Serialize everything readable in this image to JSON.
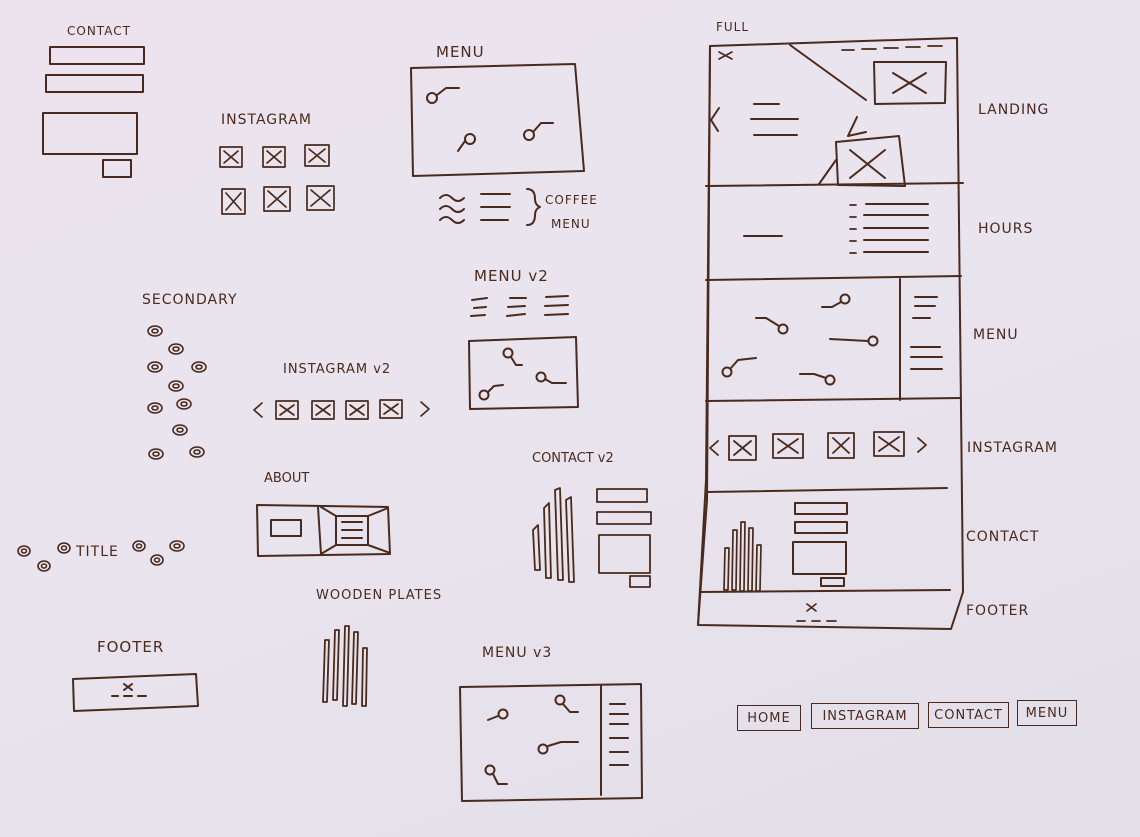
{
  "sketches": {
    "contact": "CONTACT",
    "instagram": "INSTAGRAM",
    "menu": "MENU",
    "coffee_menu_1": "COFFEE",
    "coffee_menu_2": "MENU",
    "menu_v2": "MENU v2",
    "secondary": "SECONDARY",
    "instagram_v2": "INSTAGRAM v2",
    "about": "ABOUT",
    "contact_v2": "CONTACT v2",
    "title": "TITLE",
    "wooden_plates": "WOODEN PLATES",
    "footer": "FOOTER",
    "menu_v3": "MENU v3"
  },
  "full_page": {
    "label": "FULL",
    "sections": [
      "LANDING",
      "HOURS",
      "MENU",
      "INSTAGRAM",
      "CONTACT",
      "FOOTER"
    ]
  },
  "nav": [
    "HOME",
    "INSTAGRAM",
    "CONTACT",
    "MENU"
  ],
  "colors": {
    "ink": "#4a2a1c",
    "paper": "#ebe5ee"
  }
}
